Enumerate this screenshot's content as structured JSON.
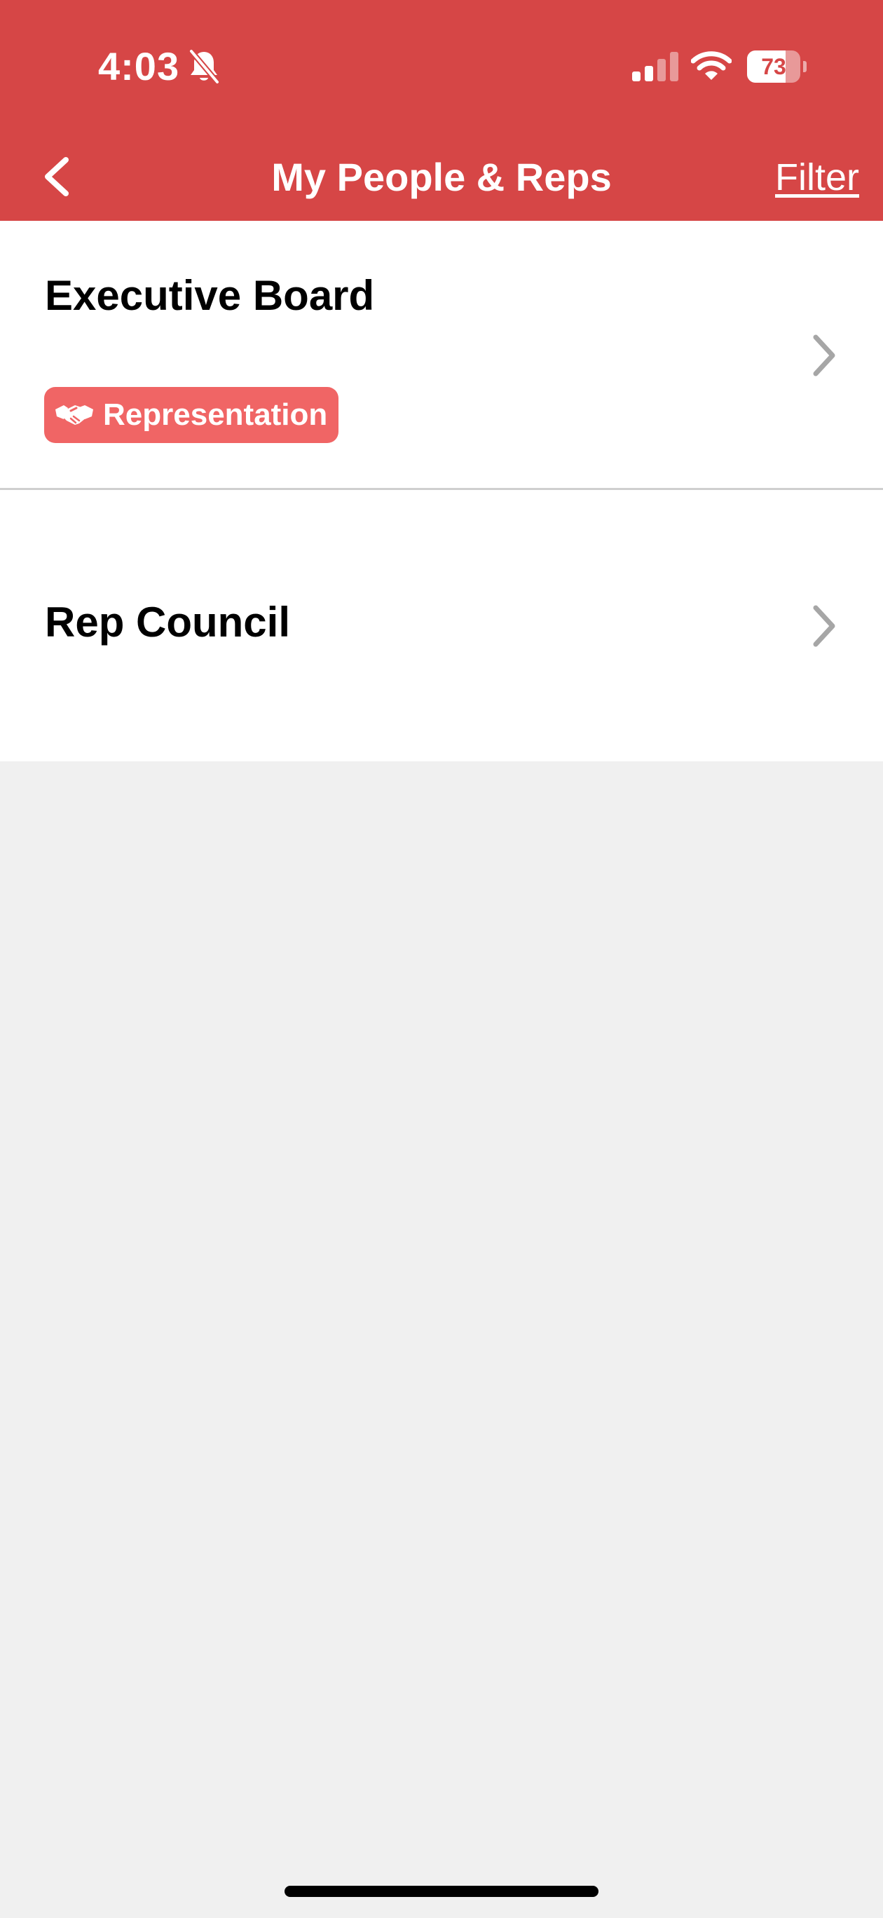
{
  "status_bar": {
    "time": "4:03",
    "battery_level": 73,
    "battery_text": "73",
    "bell_icon": "bell-slash-icon",
    "signal_icon": "cellular-signal-icon",
    "wifi_icon": "wifi-icon"
  },
  "header": {
    "title": "My People & Reps",
    "filter_label": "Filter",
    "back_icon": "chevron-left-icon"
  },
  "list": {
    "items": [
      {
        "title": "Executive Board",
        "tag": {
          "label": "Representation",
          "icon": "handshake-icon"
        }
      },
      {
        "title": "Rep Council"
      }
    ]
  },
  "colors": {
    "header_bg": "#d64646",
    "tag_bg": "#f06565",
    "page_bg": "#f0f0f0",
    "chevron": "#a6a6a6"
  }
}
